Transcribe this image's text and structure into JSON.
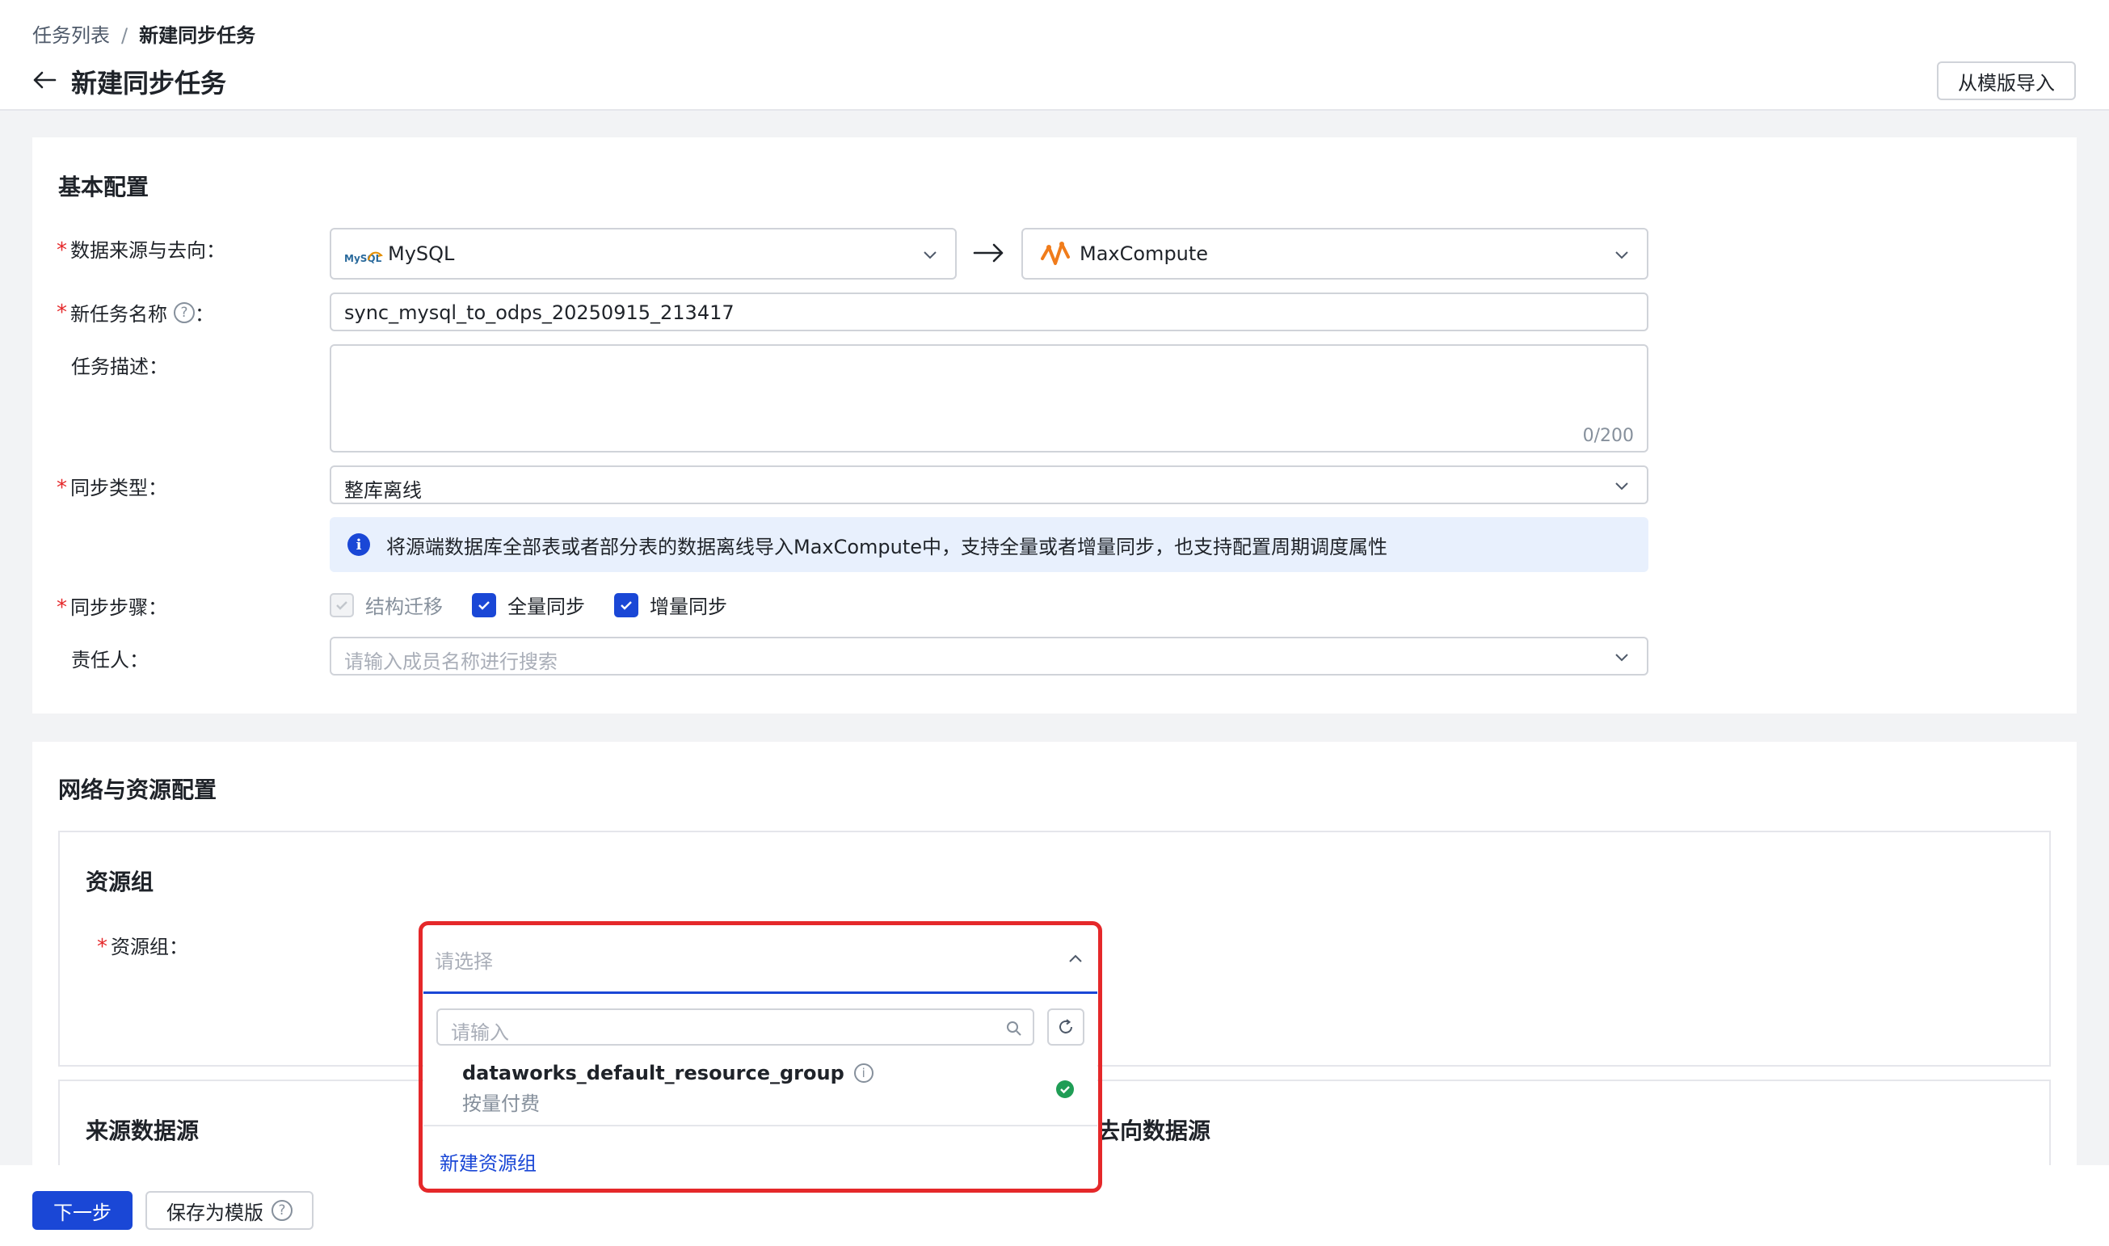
{
  "breadcrumb": {
    "root": "任务列表",
    "separator": "/",
    "current": "新建同步任务"
  },
  "page_title": "新建同步任务",
  "import_button": "从模版导入",
  "basic": {
    "title": "基本配置",
    "source_label": "数据来源与去向：",
    "source_value": "MySQL",
    "source_logo_text": "MySQL",
    "target_value": "MaxCompute",
    "name_label": "新任务名称",
    "name_colon": "：",
    "name_value": "sync_mysql_to_odps_20250915_213417",
    "desc_label": "任务描述：",
    "desc_counter": "0/200",
    "sync_type_label": "同步类型：",
    "sync_type_value": "整库离线",
    "info_text": "将源端数据库全部表或者部分表的数据离线导入MaxCompute中，支持全量或者增量同步，也支持配置周期调度属性",
    "steps_label": "同步步骤：",
    "steps": [
      {
        "label": "结构迁移",
        "checked": true,
        "disabled": true
      },
      {
        "label": "全量同步",
        "checked": true,
        "disabled": false
      },
      {
        "label": "增量同步",
        "checked": true,
        "disabled": false
      }
    ],
    "owner_label": "责任人：",
    "owner_placeholder": "请输入成员名称进行搜索"
  },
  "network": {
    "title": "网络与资源配置",
    "resource_group_section": "资源组",
    "resource_group_label": "资源组：",
    "resource_group_placeholder": "请选择",
    "search_placeholder": "请输入",
    "options": [
      {
        "name": "dataworks_default_resource_group",
        "sub": "按量付费",
        "status": "available"
      }
    ],
    "new_group_link": "新建资源组",
    "source_ds_title": "来源数据源",
    "target_ds_title": "去向数据源"
  },
  "footer": {
    "next": "下一步",
    "save_template": "保存为模版"
  },
  "colors": {
    "primary": "#1a47d6",
    "required": "#e5282a",
    "success": "#1f9d55",
    "info_bg": "#e8f0fd"
  }
}
